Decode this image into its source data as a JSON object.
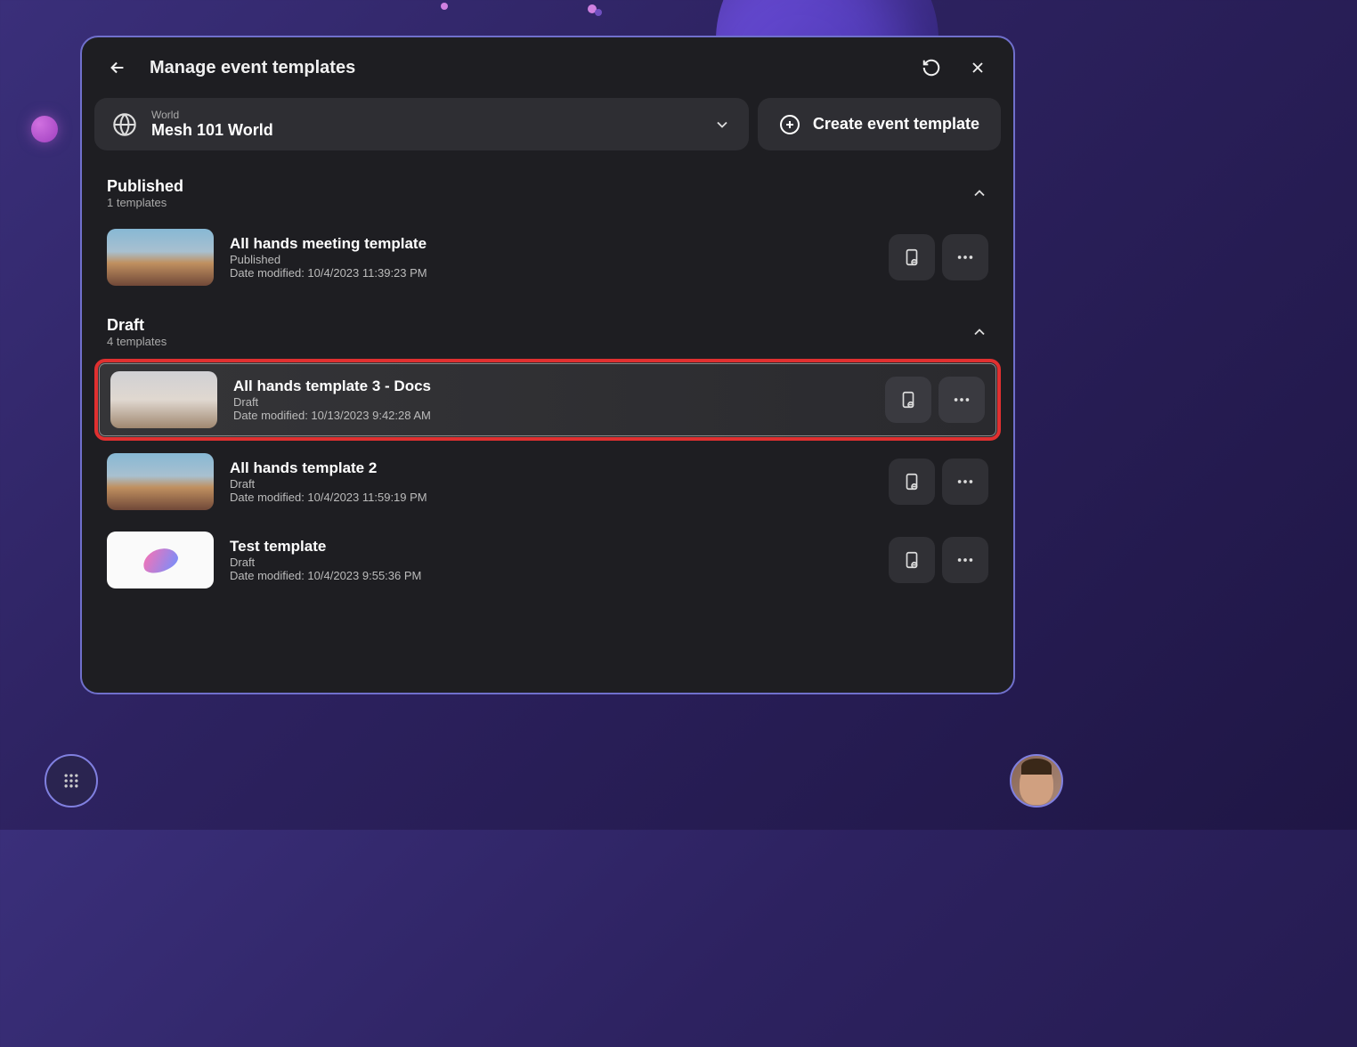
{
  "header": {
    "title": "Manage event templates"
  },
  "world": {
    "label": "World",
    "name": "Mesh 101 World"
  },
  "create_button": "Create event template",
  "date_prefix": "Date modified: ",
  "sections": [
    {
      "name": "Published",
      "count": "1 templates",
      "templates": [
        {
          "name": "All hands meeting template",
          "status": "Published",
          "date": "10/4/2023 11:39:23 PM",
          "thumb": "scene",
          "highlighted": false
        }
      ]
    },
    {
      "name": "Draft",
      "count": "4 templates",
      "templates": [
        {
          "name": "All hands template 3 - Docs",
          "status": "Draft",
          "date": "10/13/2023 9:42:28 AM",
          "thumb": "scene2",
          "highlighted": true
        },
        {
          "name": "All hands template 2",
          "status": "Draft",
          "date": "10/4/2023 11:59:19 PM",
          "thumb": "scene",
          "highlighted": false
        },
        {
          "name": "Test template",
          "status": "Draft",
          "date": "10/4/2023 9:55:36 PM",
          "thumb": "light",
          "highlighted": false
        }
      ]
    }
  ]
}
